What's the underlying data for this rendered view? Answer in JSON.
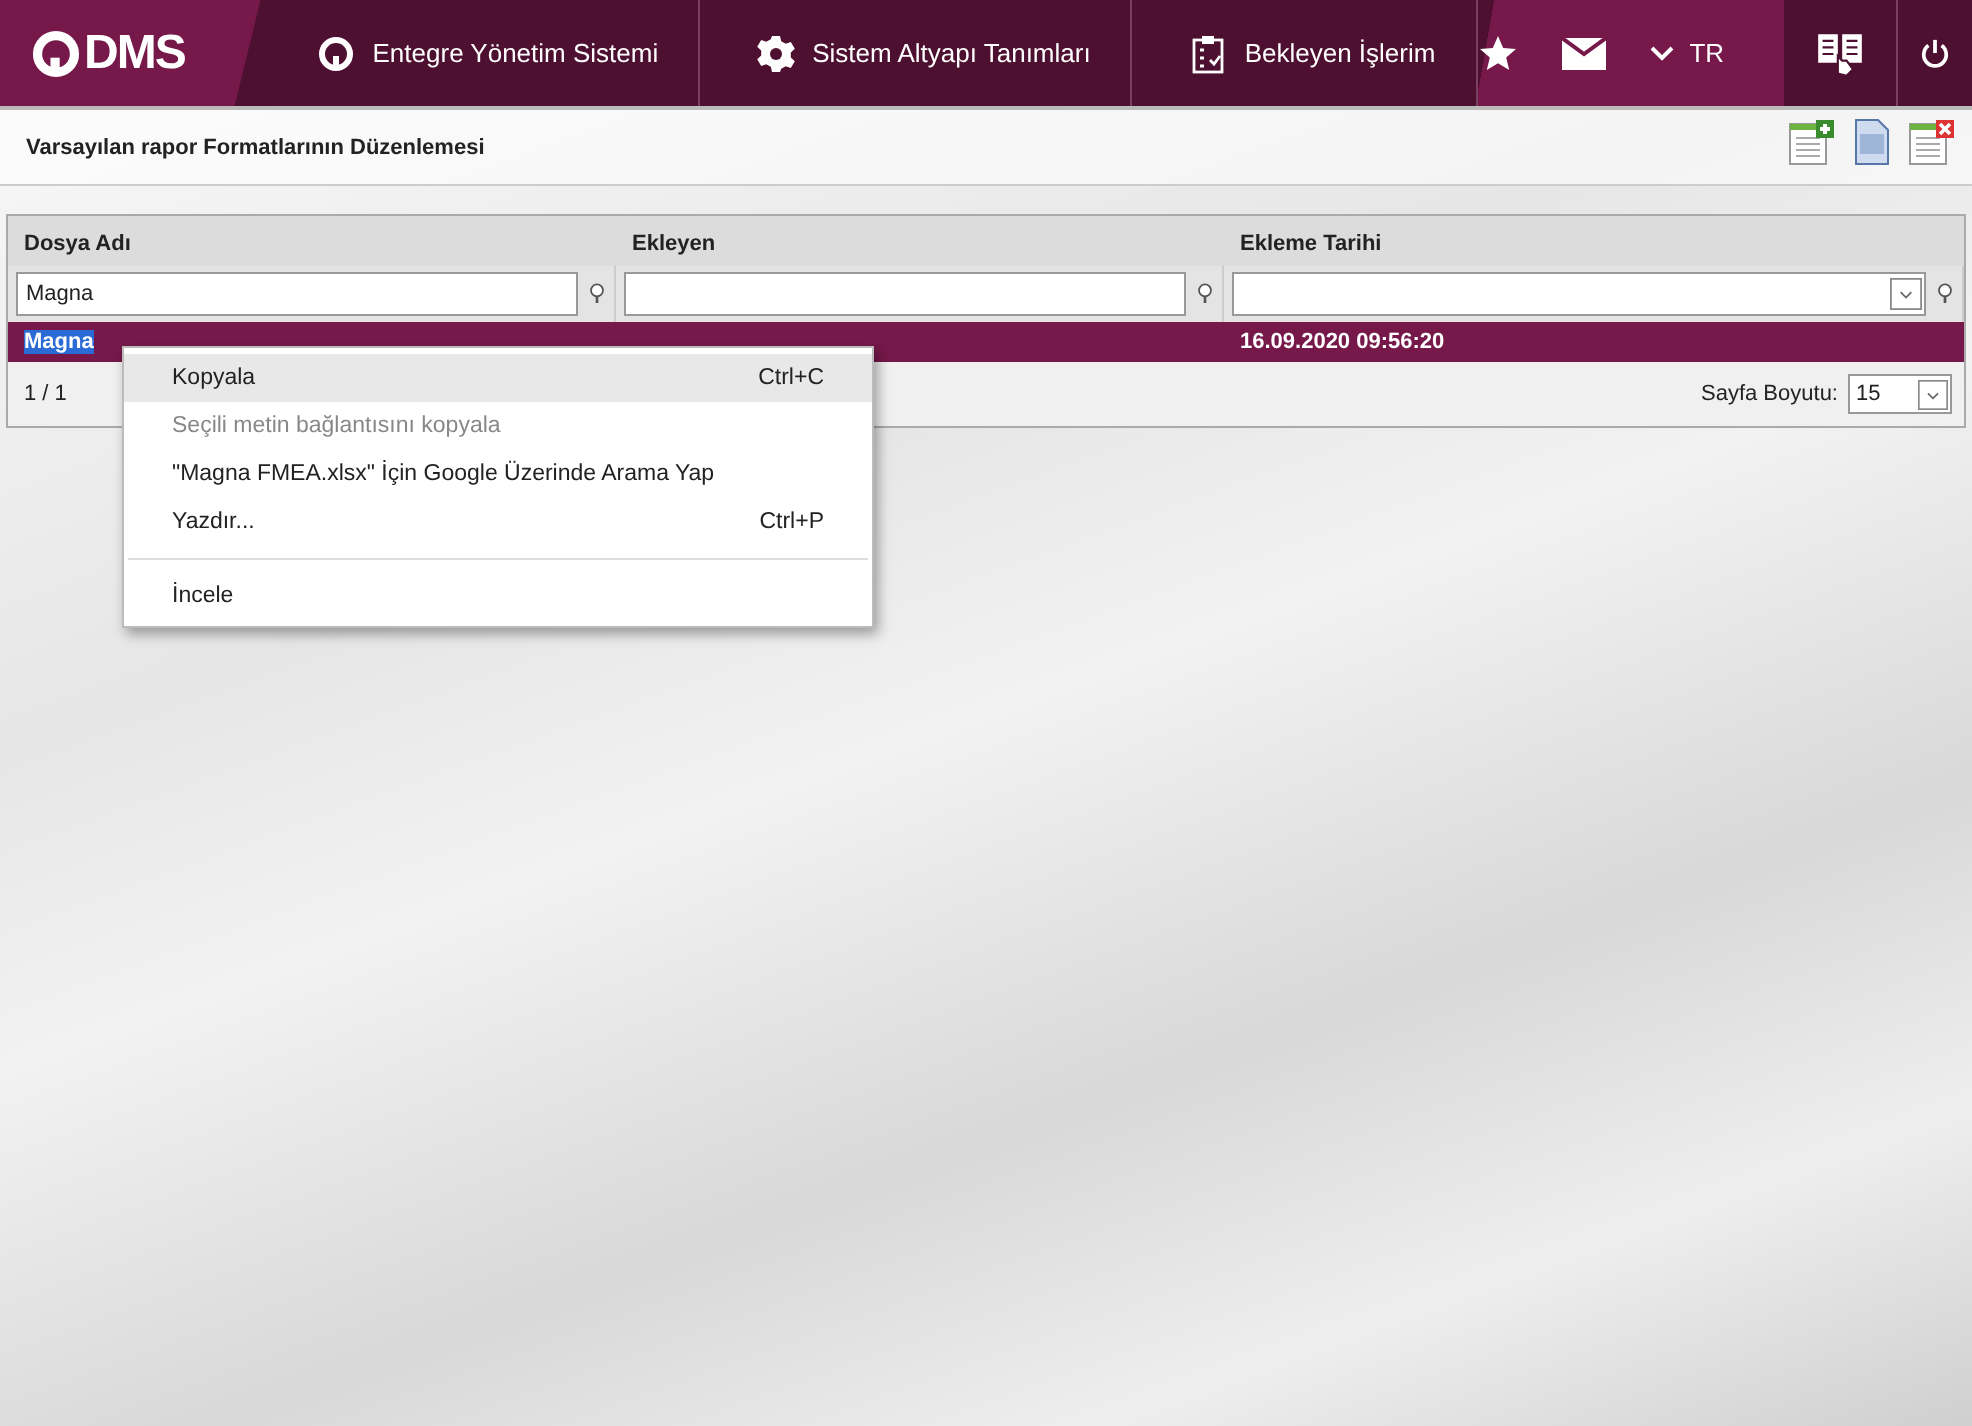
{
  "header": {
    "logo": "DMS",
    "nav": [
      {
        "label": "Entegre Yönetim Sistemi",
        "kind": "q"
      },
      {
        "label": "Sistem Altyapı Tanımları",
        "kind": "gear"
      },
      {
        "label": "Bekleyen İşlerim",
        "kind": "clipboard"
      }
    ],
    "language": "TR"
  },
  "page_title": "Varsayılan rapor Formatlarının Düzenlemesi",
  "grid": {
    "columns": [
      {
        "label": "Dosya Adı",
        "filter": {
          "kind": "text",
          "value": "Magna"
        }
      },
      {
        "label": "Ekleyen",
        "filter": {
          "kind": "text"
        }
      },
      {
        "label": "Ekleme Tarihi",
        "filter": {
          "kind": "date"
        }
      }
    ],
    "rows": [
      {
        "file_name": "Magna",
        "date": "16.09.2020 09:56:20",
        "selected": true
      }
    ],
    "pager": {
      "page": "1 / 1",
      "page_size_label": "Sayfa Boyutu:",
      "page_size": "15"
    }
  },
  "context_menu": [
    {
      "kind": "item",
      "label": "Kopyala",
      "shortcut": "Ctrl+C",
      "disabled": false,
      "selected": true
    },
    {
      "kind": "item",
      "label": "Seçili metin bağlantısını kopyala",
      "disabled": true,
      "selected": false
    },
    {
      "kind": "item",
      "label": "\"Magna FMEA.xlsx\" İçin Google Üzerinde Arama Yap",
      "disabled": false,
      "selected": false
    },
    {
      "kind": "item",
      "label": "Yazdır...",
      "shortcut": "Ctrl+P",
      "disabled": false,
      "selected": false
    },
    {
      "kind": "separator"
    },
    {
      "kind": "item",
      "label": "İncele",
      "disabled": false,
      "selected": false
    }
  ]
}
